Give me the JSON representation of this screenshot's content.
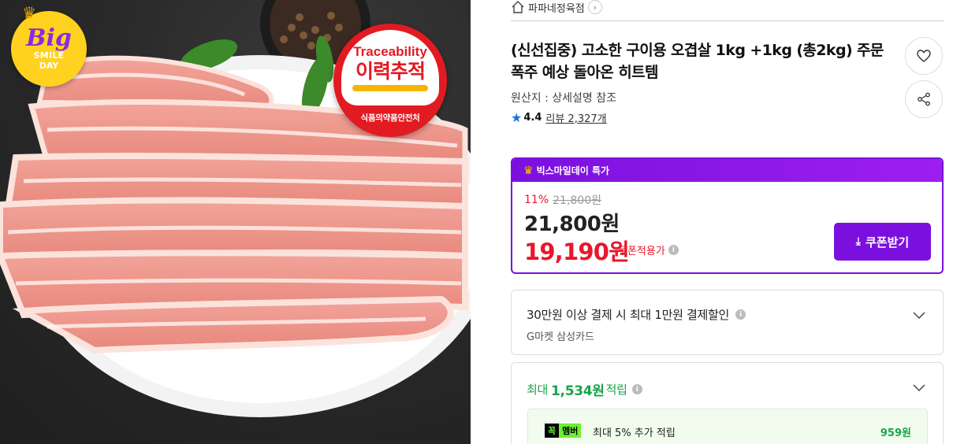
{
  "image": {
    "badge_big": {
      "big": "Big",
      "smile": "SMILE",
      "day": "DAY"
    },
    "trace_badge": {
      "en": "Traceability",
      "ko": "이력추적",
      "org": "식품의약품안전처"
    }
  },
  "shop": {
    "name": "파파네정육점",
    "arrow": "›"
  },
  "product": {
    "title": "(신선집중) 고소한 구이용 오겹살 1kg +1kg (총2kg) 주문폭주 예상 돌아온 히트템",
    "origin": "원산지 : 상세설명 참조",
    "rating": "4.4",
    "reviews": "리뷰 2,327개"
  },
  "deal": {
    "label": "빅스마일데이 특가",
    "discount": "11%",
    "original_price": "21,800원",
    "sale_price": "21,800원",
    "coupon_price": "19,190원",
    "coupon_note": "쿠폰적용가",
    "coupon_button": "쿠폰받기"
  },
  "card_offer": {
    "main": "30만원 이상 결제 시 최대 1만원 결제할인",
    "sub": "G마켓 삼성카드"
  },
  "points": {
    "prefix": "최대",
    "amount": "1,534원",
    "suffix": "적립",
    "member_k": "꼭",
    "member_m": "멤버",
    "member_text": "최대 5% 추가 적립",
    "member_amount": "959원"
  },
  "colors": {
    "accent_purple": "#7b10de",
    "price_red": "#e8172b",
    "point_green": "#1aa34a",
    "trace_red": "#e21a22",
    "badge_yellow": "#ffd21f"
  }
}
